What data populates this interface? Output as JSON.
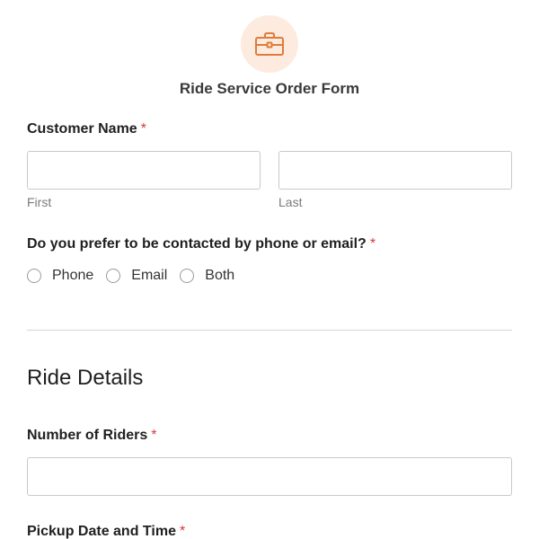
{
  "form": {
    "title": "Ride Service Order Form",
    "icon": "briefcase-icon",
    "accent_color": "#e07b39",
    "icon_bg_color": "#fdebe0",
    "required_color": "#d63b3b"
  },
  "customer_name": {
    "label": "Customer Name",
    "required_mark": "*",
    "first": {
      "value": "",
      "sublabel": "First"
    },
    "last": {
      "value": "",
      "sublabel": "Last"
    }
  },
  "contact_preference": {
    "label": "Do you prefer to be contacted by phone or email?",
    "required_mark": "*",
    "options": [
      "Phone",
      "Email",
      "Both"
    ]
  },
  "ride_details": {
    "section_title": "Ride Details"
  },
  "number_of_riders": {
    "label": "Number of Riders",
    "required_mark": "*",
    "value": ""
  },
  "pickup": {
    "label": "Pickup Date and Time",
    "required_mark": "*"
  }
}
